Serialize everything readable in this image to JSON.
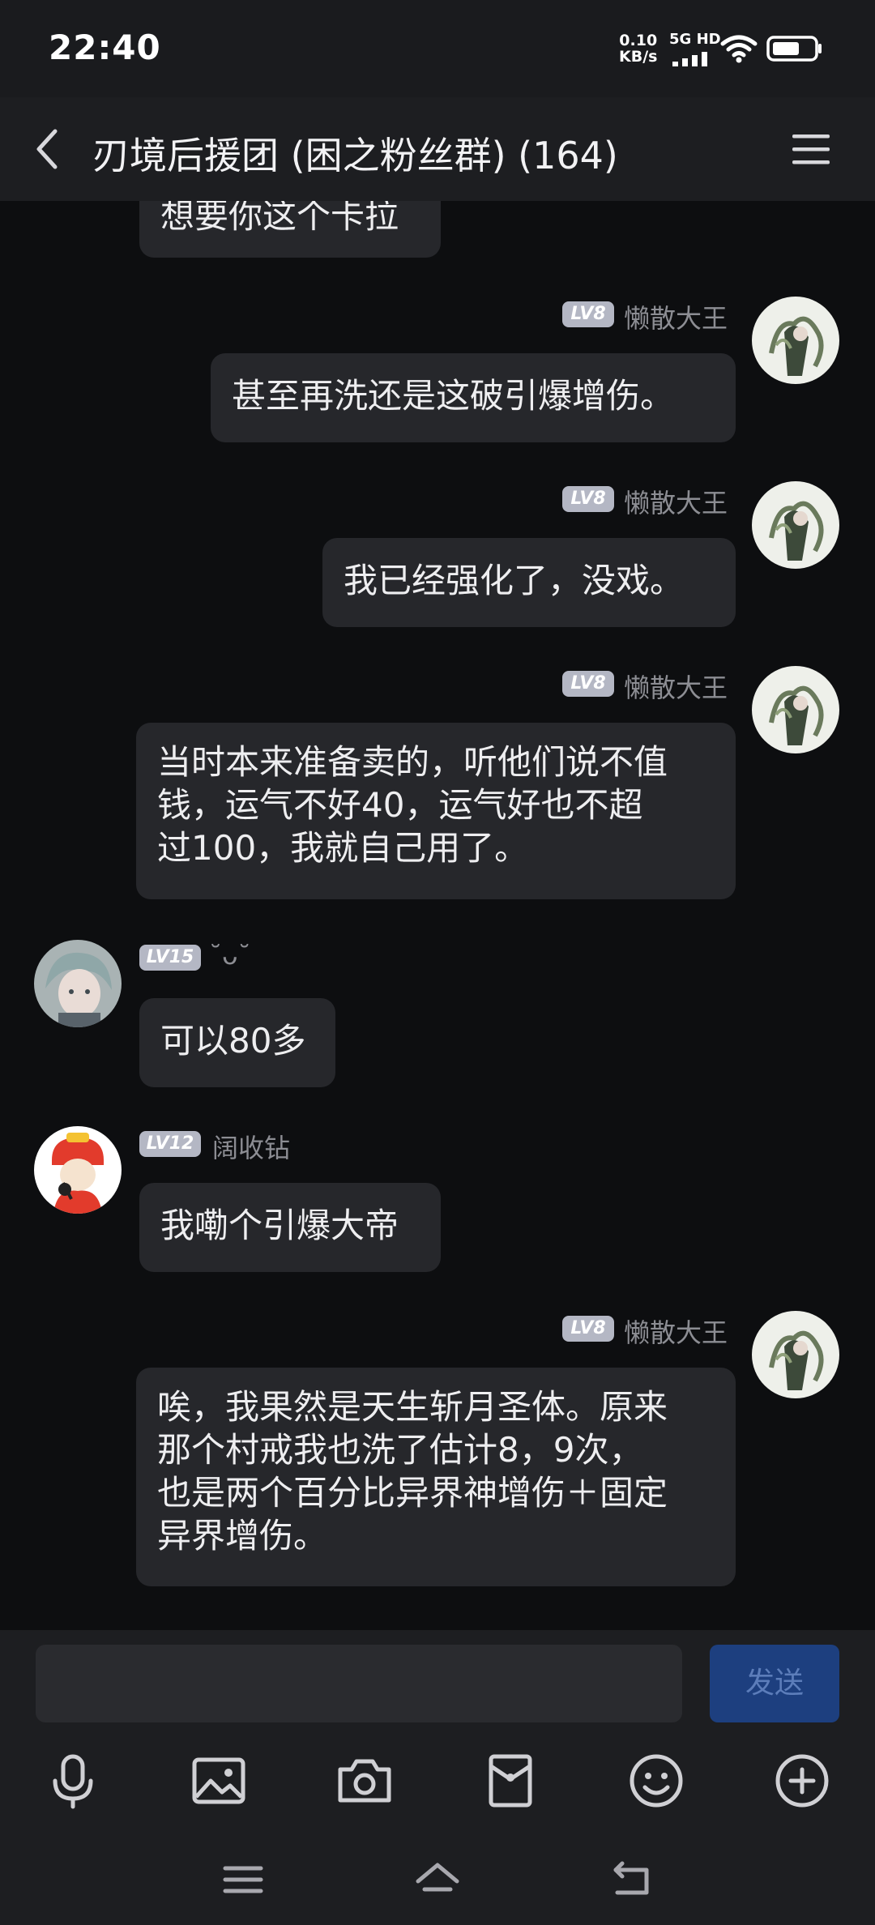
{
  "status_bar": {
    "time": "22:40",
    "network_speed_value": "0.10",
    "network_speed_unit": "KB/s",
    "signal_label": "5G HD"
  },
  "header": {
    "title": "刃境后援团 (困之粉丝群) (164)"
  },
  "messages": [
    {
      "side": "left",
      "text": "想要你这个卡拉"
    },
    {
      "side": "right",
      "level": "LV8",
      "nickname": "懒散大王",
      "text": "甚至再洗还是这破引爆增伤。"
    },
    {
      "side": "right",
      "level": "LV8",
      "nickname": "懒散大王",
      "text": "我已经强化了，没戏。"
    },
    {
      "side": "right",
      "level": "LV8",
      "nickname": "懒散大王",
      "lines": [
        "当时本来准备卖的，听他们说不值",
        "钱，运气不好40，运气好也不超",
        "过100，我就自己用了。"
      ]
    },
    {
      "side": "left",
      "level": "LV15",
      "nickname": "˘ᴗ˘",
      "text": "可以80多"
    },
    {
      "side": "left",
      "level": "LV12",
      "nickname": "阔收钻",
      "text": "我嘞个引爆大帝"
    },
    {
      "side": "right",
      "level": "LV8",
      "nickname": "懒散大王",
      "lines": [
        "唉，我果然是天生斩月圣体。原来",
        "那个村戒我也洗了估计8，9次，",
        "也是两个百分比异界神增伤＋固定",
        "异界增伤。"
      ]
    }
  ],
  "input_bar": {
    "send_label": "发送"
  },
  "toolbar_icons": [
    "microphone-icon",
    "image-icon",
    "camera-icon",
    "red-packet-icon",
    "emoji-icon",
    "plus-icon"
  ],
  "nav_icons": [
    "menu-icon",
    "home-icon",
    "back-icon"
  ],
  "colors": {
    "background": "#0d0e10",
    "bubble": "#26272b",
    "send_button": "#1d3f7f",
    "level_badge": "#b4b7c4"
  }
}
